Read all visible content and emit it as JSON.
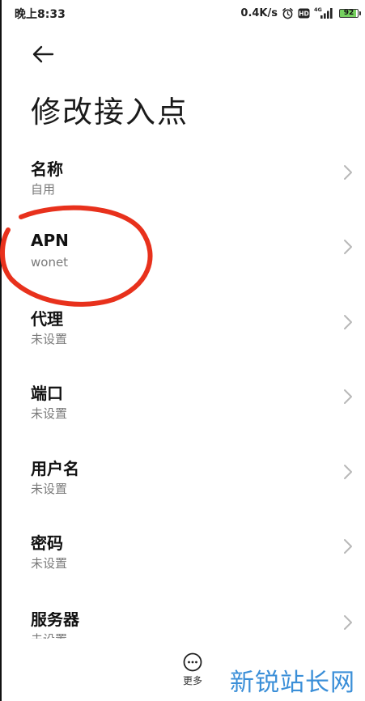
{
  "status_bar": {
    "time": "晚上8:33",
    "speed": "0.4K/s",
    "battery": "92",
    "icons": [
      "alarm-icon",
      "hd-icon",
      "4g-signal-icon",
      "battery-icon"
    ]
  },
  "header": {
    "back_icon": "arrow-left-icon",
    "title": "修改接入点"
  },
  "items": [
    {
      "label": "名称",
      "value": "自用"
    },
    {
      "label": "APN",
      "value": "wonet"
    },
    {
      "label": "代理",
      "value": "未设置"
    },
    {
      "label": "端口",
      "value": "未设置"
    },
    {
      "label": "用户名",
      "value": "未设置"
    },
    {
      "label": "密码",
      "value": "未设置"
    },
    {
      "label": "服务器",
      "value": "未设置"
    }
  ],
  "bottom_bar": {
    "more_label": "更多",
    "more_icon": "more-dots-icon"
  },
  "watermark": "新锐站长网",
  "colors": {
    "annotation": "#e8311c",
    "battery": "#76d160",
    "watermark": "#3b8fd8",
    "secondary_text": "#7a7a7a",
    "chevron": "#b8b8b8"
  }
}
